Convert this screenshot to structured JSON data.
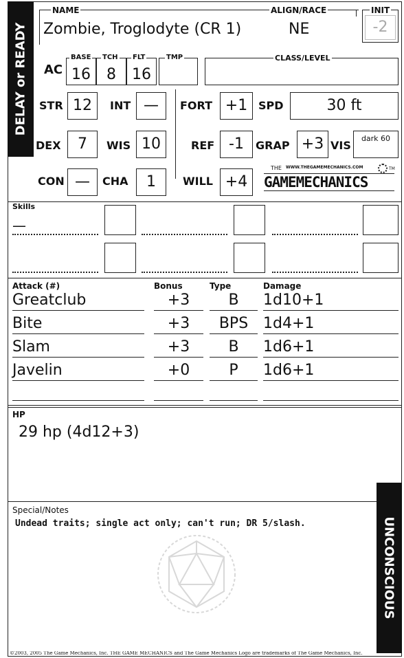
{
  "sidebar_left": "DELAY or READY",
  "sidebar_right": "UNCONSCIOUS",
  "header": {
    "name_label": "NAME",
    "name_value": "Zombie, Troglodyte (CR 1)",
    "align_label": "ALIGN/RACE",
    "align_value": "NE",
    "init_label": "INIT",
    "init_value": "-2"
  },
  "ac": {
    "label": "AC",
    "base_label": "BASE",
    "base_value": "16",
    "tch_label": "TCH",
    "tch_value": "8",
    "flt_label": "FLT",
    "flt_value": "16",
    "tmp_label": "TMP",
    "tmp_value": ""
  },
  "class_level": {
    "label": "CLASS/LEVEL",
    "value": ""
  },
  "abilities": {
    "str": {
      "label": "STR",
      "value": "12"
    },
    "int": {
      "label": "INT",
      "value": "—"
    },
    "dex": {
      "label": "DEX",
      "value": "7"
    },
    "wis": {
      "label": "WIS",
      "value": "10"
    },
    "con": {
      "label": "CON",
      "value": "—"
    },
    "cha": {
      "label": "CHA",
      "value": "1"
    }
  },
  "saves": {
    "fort": {
      "label": "FORT",
      "value": "+1"
    },
    "ref": {
      "label": "REF",
      "value": "-1"
    },
    "will": {
      "label": "WILL",
      "value": "+4"
    }
  },
  "spd": {
    "label": "SPD",
    "value": "30 ft"
  },
  "grap": {
    "label": "GRAP",
    "value": "+3"
  },
  "vis": {
    "label": "VIS",
    "value": "dark 60"
  },
  "logo": {
    "url_text": "WWW.THEGAMEMECHANICS.COM",
    "the": "THE",
    "text": "GAMEMECHANICS",
    "tm": "TM"
  },
  "skills": {
    "label": "Skills",
    "first_entry": "—"
  },
  "attacks": {
    "label": "Attack (#)",
    "bonus_label": "Bonus",
    "type_label": "Type",
    "damage_label": "Damage",
    "rows": [
      {
        "name": "Greatclub",
        "bonus": "+3",
        "type": "B",
        "damage": "1d10+1"
      },
      {
        "name": "Bite",
        "bonus": "+3",
        "type": "BPS",
        "damage": "1d4+1"
      },
      {
        "name": "Slam",
        "bonus": "+3",
        "type": "B",
        "damage": "1d6+1"
      },
      {
        "name": "Javelin",
        "bonus": "+0",
        "type": "P",
        "damage": "1d6+1"
      }
    ]
  },
  "hp": {
    "label": "HP",
    "value": "29 hp (4d12+3)"
  },
  "notes": {
    "label": "Special/Notes",
    "value": "Undead traits; single act only; can't run; DR 5/slash."
  },
  "footer": "©2003, 2005 The Game Mechanics, Inc. THE GAME MECHANICS and The Game Mechanics Logo are trademarks of The Game Mechanics, Inc."
}
